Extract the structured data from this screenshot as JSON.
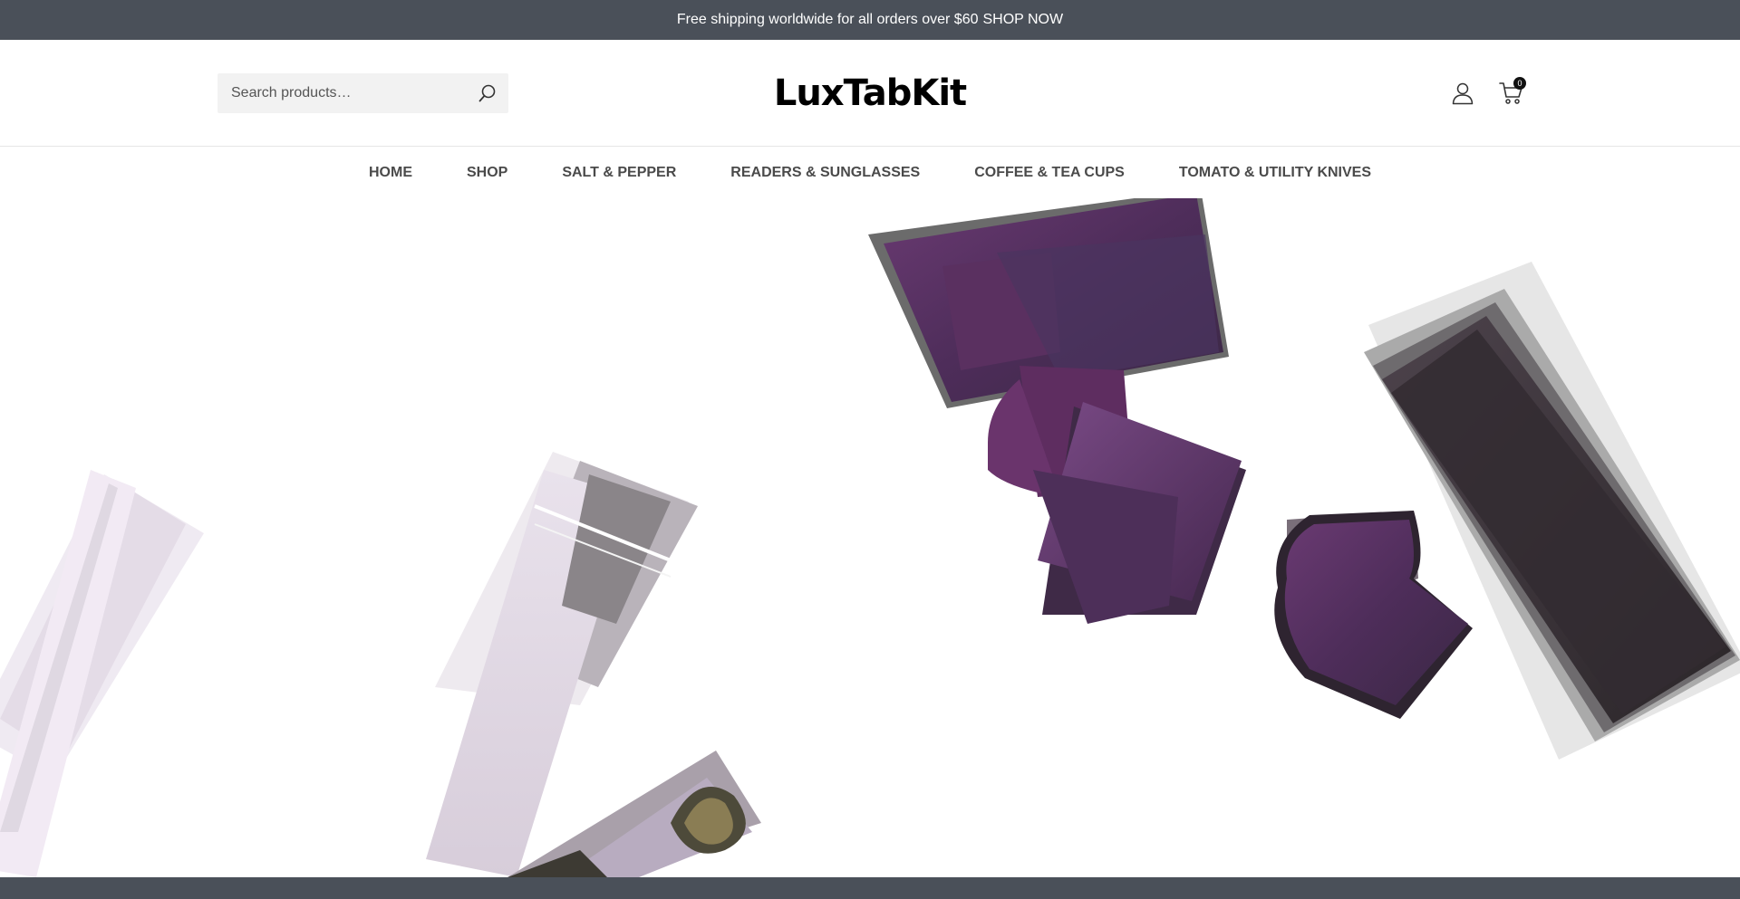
{
  "announcement": {
    "text": "Free shipping worldwide for all orders over $60",
    "link": "SHOP NOW"
  },
  "header": {
    "search_placeholder": "Search products…",
    "logo": "LuxTabKit",
    "cart_count": "0"
  },
  "nav": {
    "items": [
      "HOME",
      "SHOP",
      "SALT & PEPPER",
      "READERS & SUNGLASSES",
      "COFFEE & TEA CUPS",
      "TOMATO & UTILITY KNIVES"
    ]
  },
  "colors": {
    "topbar": "#4a5059",
    "nav_text": "#4a4a4a",
    "purple": "#5a2d5e",
    "dark": "#2e2a2e"
  },
  "icons": [
    "search-icon",
    "account-icon",
    "cart-icon"
  ]
}
